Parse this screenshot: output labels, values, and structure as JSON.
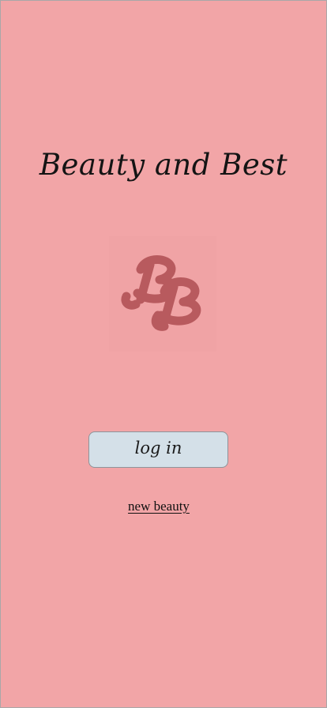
{
  "app": {
    "title": "Beauty and Best",
    "logo_text": "BB"
  },
  "actions": {
    "login_label": "log in",
    "register_label": "new beauty"
  },
  "colors": {
    "background": "#f2a5a7",
    "logo": "#b85a5e",
    "button_fill": "#d4e0e8",
    "button_border": "#8d949a",
    "text": "#141414"
  },
  "icons": {
    "logo": "bb-monogram-logo"
  }
}
